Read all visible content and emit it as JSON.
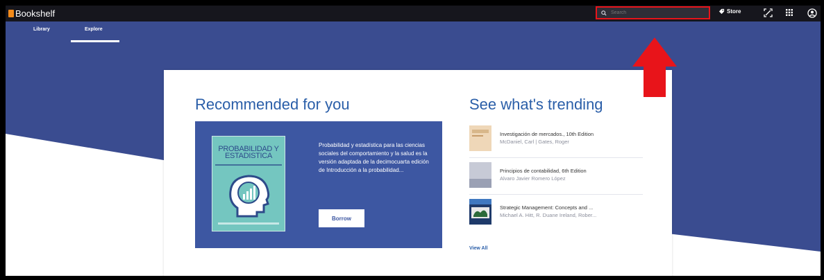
{
  "app": {
    "title": "Bookshelf"
  },
  "search": {
    "placeholder": "Search"
  },
  "topbar": {
    "store_label": "Store",
    "icons": [
      "search-icon",
      "tag-icon",
      "scan-icon",
      "grid-icon",
      "account-icon"
    ]
  },
  "tabs": [
    {
      "label": "Library"
    },
    {
      "label": "Explore",
      "active": true
    }
  ],
  "recommended": {
    "heading": "Recommended for you",
    "book": {
      "cover_title": "PROBABILIDAD Y ESTADISTICA",
      "description": "Probabilidad y estadística para las ciencias sociales del comportamiento y la salud es la versión adaptada de la decimocuarta edición de Introducción a la probabilidad...",
      "button_label": "Borrow"
    }
  },
  "trending": {
    "heading": "See what's trending",
    "items": [
      {
        "title": "Investigación de mercados., 10th Edition",
        "author": "McDaniel, Carl | Gates, Roger"
      },
      {
        "title": "Principios de contabilidad, 6th Edition",
        "author": "Alvaro Javier Romero López"
      },
      {
        "title": "Strategic Management: Concepts and ...",
        "author": "Michael A. Hitt, R. Duane Ireland, Rober..."
      }
    ],
    "view_all_label": "View All"
  },
  "colors": {
    "topbar": "#16161d",
    "brand_blue": "#3a4c90",
    "heading_blue": "#2a5ea8",
    "highlight_red": "#e8141a",
    "logo_orange": "#f28a1a"
  }
}
